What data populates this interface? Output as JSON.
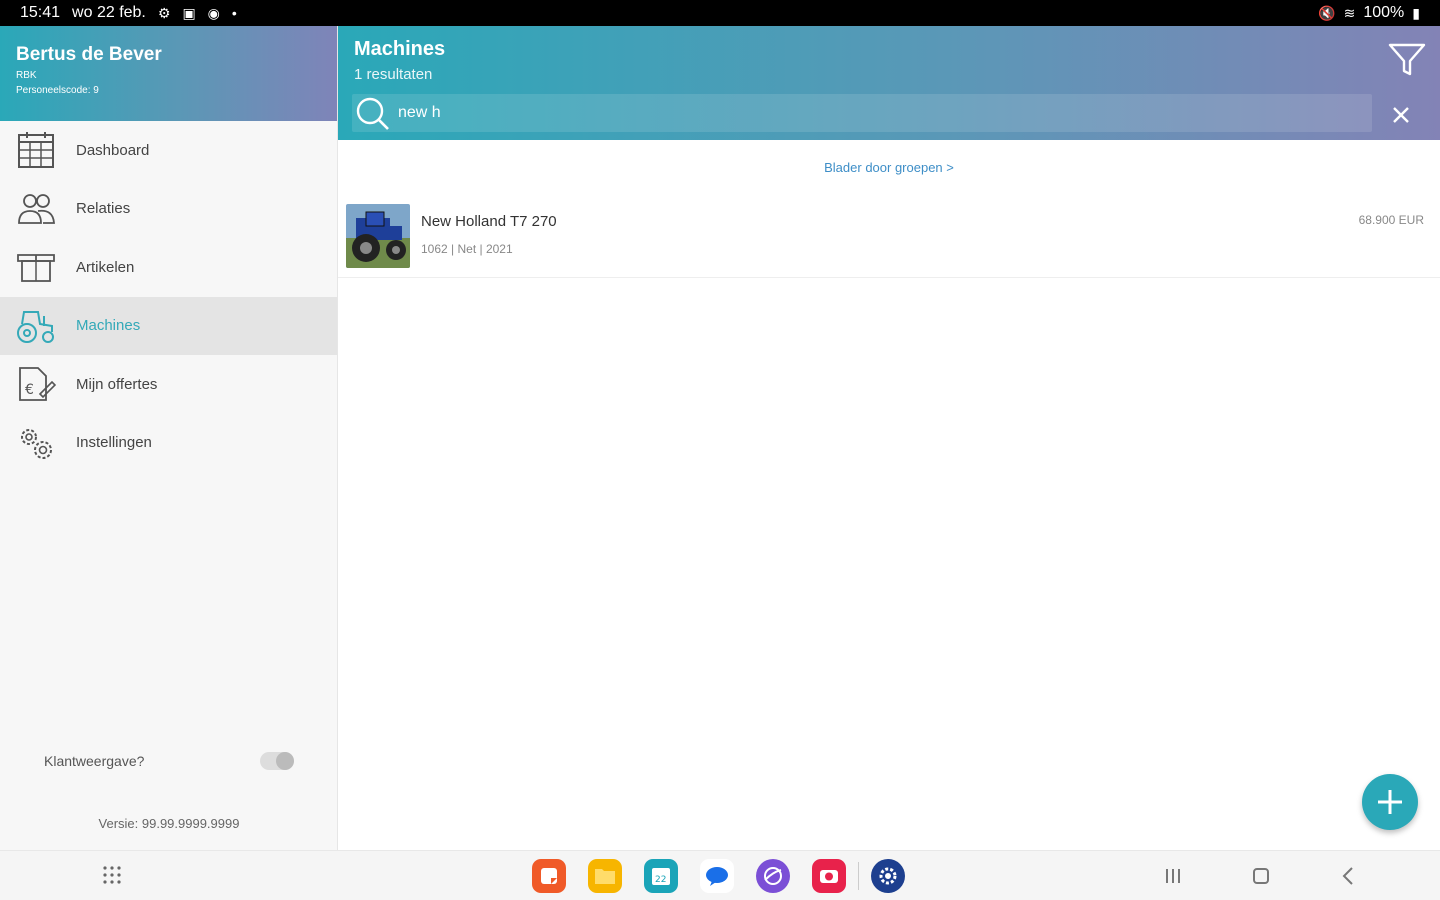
{
  "status": {
    "time": "15:41",
    "date": "wo 22 feb.",
    "battery": "100%"
  },
  "sidebar": {
    "user_name": "Bertus de Bever",
    "user_company": "RBK",
    "user_code": "Personeelscode: 9",
    "items": [
      {
        "label": "Dashboard",
        "icon": "calendar-icon"
      },
      {
        "label": "Relaties",
        "icon": "people-icon"
      },
      {
        "label": "Artikelen",
        "icon": "box-icon"
      },
      {
        "label": "Machines",
        "icon": "tractor-icon"
      },
      {
        "label": "Mijn offertes",
        "icon": "quote-icon"
      },
      {
        "label": "Instellingen",
        "icon": "gears-icon"
      }
    ],
    "active_index": 3,
    "toggle_label": "Klantweergave?",
    "version": "Versie: 99.99.9999.9999"
  },
  "header": {
    "title": "Machines",
    "count": "1 resultaten",
    "search_value": "new h"
  },
  "content": {
    "browse_link": "Blader door groepen  >",
    "items": [
      {
        "title": "New Holland T7 270",
        "meta": "1062 | Net | 2021",
        "price": "68.900 EUR"
      }
    ]
  },
  "colors": {
    "accent": "#2aa8b8",
    "gradient_end": "#8383b6",
    "link": "#3e8ec7"
  }
}
